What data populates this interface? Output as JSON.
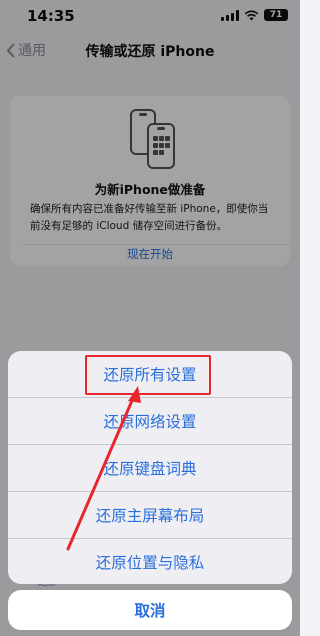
{
  "status_bar": {
    "time": "14:35",
    "battery": "71"
  },
  "nav": {
    "back_label": "通用",
    "title": "传输或还原 iPhone"
  },
  "card": {
    "title": "为新iPhone做准备",
    "description": "确保所有内容已准备好传输至新 iPhone，即使你当前没有足够的 iCloud 储存空间进行备份。",
    "start_link": "现在开始"
  },
  "background_link": "还原",
  "action_sheet": {
    "items": [
      {
        "label": "还原所有设置"
      },
      {
        "label": "还原网络设置"
      },
      {
        "label": "还原键盘词典"
      },
      {
        "label": "还原主屏幕布局"
      },
      {
        "label": "还原位置与隐私"
      }
    ],
    "cancel_label": "取消"
  },
  "colors": {
    "accent": "#2a6fdb",
    "annotation": "#e8262d",
    "background": "#f2f2f7"
  }
}
